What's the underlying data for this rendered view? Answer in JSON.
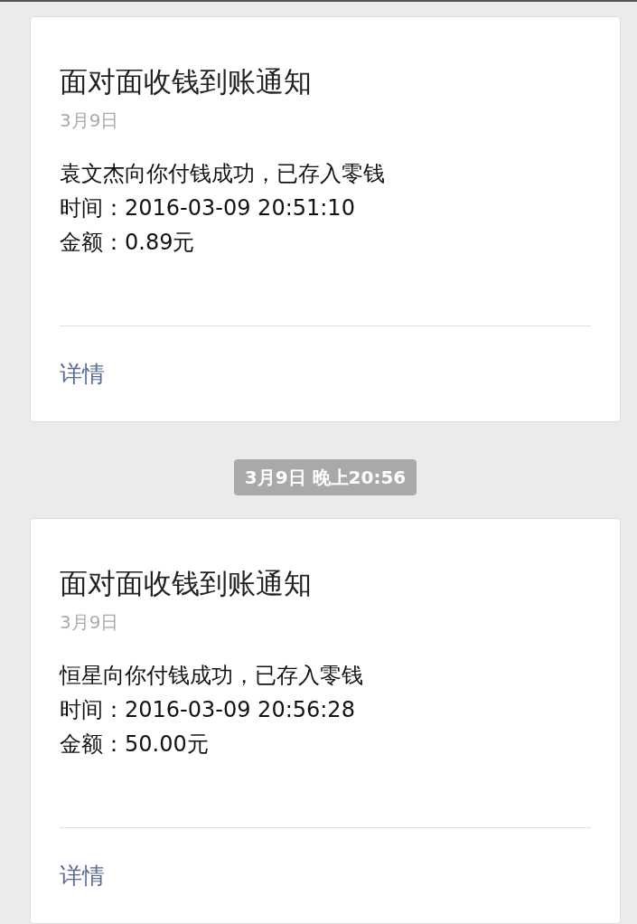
{
  "messages": [
    {
      "kind": "card",
      "title": "面对面收钱到账通知",
      "date": "3月9日",
      "lines": [
        "袁文杰向你付钱成功，已存入零钱",
        "时间：2016-03-09 20:51:10",
        "金额：0.89元"
      ],
      "link": "详情"
    },
    {
      "kind": "timestamp",
      "text": "3月9日 晚上20:56"
    },
    {
      "kind": "card",
      "title": "面对面收钱到账通知",
      "date": "3月9日",
      "lines": [
        "恒星向你付钱成功，已存入零钱",
        "时间：2016-03-09 20:56:28",
        "金额：50.00元"
      ],
      "link": "详情"
    }
  ]
}
